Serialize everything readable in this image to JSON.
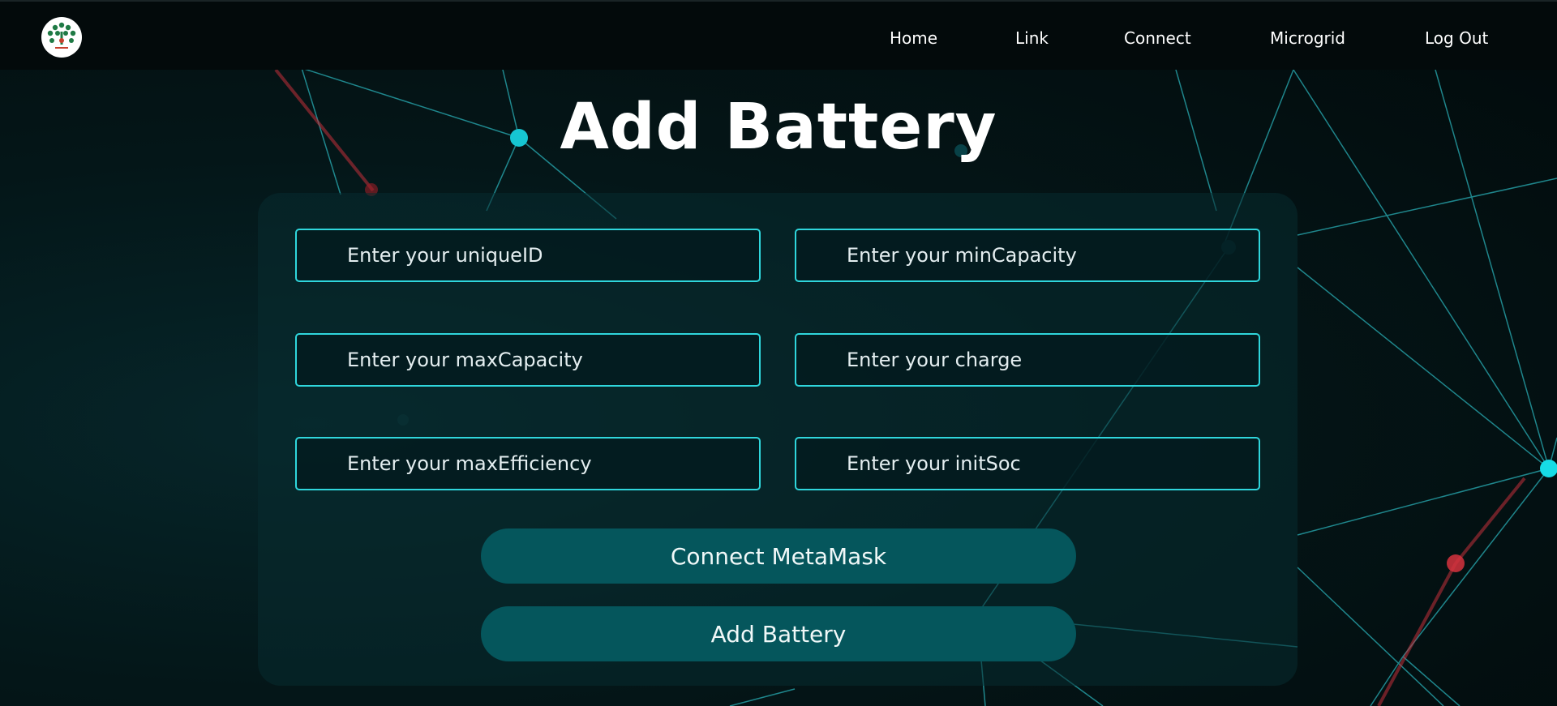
{
  "navbar": {
    "logo_alt": "",
    "links": [
      "Home",
      "Link",
      "Connect",
      "Microgrid",
      "Log Out"
    ]
  },
  "page": {
    "title": "Add Battery"
  },
  "form": {
    "fields": [
      {
        "placeholder": "Enter your uniqueID",
        "value": ""
      },
      {
        "placeholder": "Enter your minCapacity",
        "value": ""
      },
      {
        "placeholder": "Enter your maxCapacity",
        "value": ""
      },
      {
        "placeholder": "Enter your charge",
        "value": ""
      },
      {
        "placeholder": "Enter your maxEfficiency",
        "value": ""
      },
      {
        "placeholder": "Enter your initSoc",
        "value": ""
      }
    ],
    "connect_label": "Connect MetaMask",
    "submit_label": "Add Battery"
  },
  "colors": {
    "accent": "#2fd6dc",
    "button": "#05565c",
    "navbar": "#030a0b",
    "background": "#041416"
  }
}
